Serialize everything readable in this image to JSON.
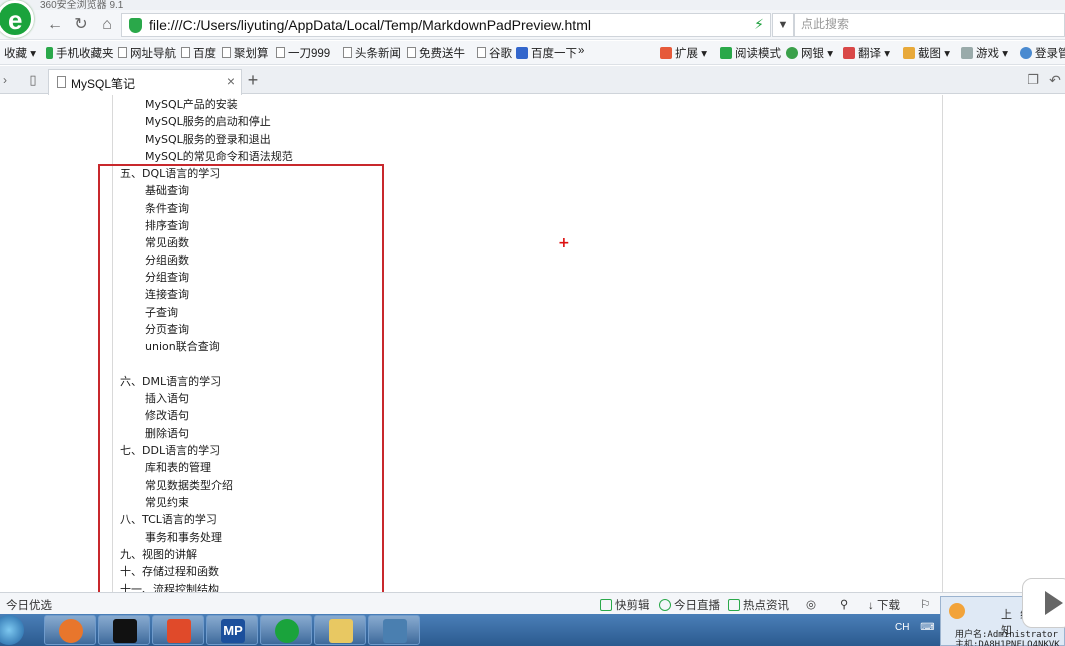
{
  "window": {
    "title": "360安全浏览器 9.1"
  },
  "nav": {
    "back_icon": "back-arrow-icon",
    "reload_icon": "reload-icon",
    "home_icon": "home-icon",
    "url": "file:///C:/Users/liyuting/AppData/Local/Temp/MarkdownPadPreview.html",
    "search_placeholder": "点此搜索"
  },
  "bookmarks": {
    "left": [
      "收藏",
      "手机收藏夹",
      "网址导航",
      "百度",
      "聚划算",
      "一刀999",
      "头条新闻",
      "免费送牛",
      "谷歌",
      "百度一下"
    ],
    "more": "»",
    "right": [
      "扩展",
      "阅读模式",
      "网银",
      "翻译",
      "截图",
      "游戏",
      "登录管"
    ]
  },
  "tabs": [
    {
      "label": "MySQL笔记"
    }
  ],
  "document": {
    "top_items": [
      "MySQL产品的安装",
      "MySQL服务的启动和停止",
      "MySQL服务的登录和退出",
      "MySQL的常见命令和语法规范"
    ],
    "sec5": {
      "title": "五、DQL语言的学习",
      "items": [
        "基础查询",
        "条件查询",
        "排序查询",
        "常见函数",
        "分组函数",
        "分组查询",
        "连接查询",
        "子查询",
        "分页查询",
        "union联合查询"
      ]
    },
    "sec6": {
      "title": "六、DML语言的学习",
      "items": [
        "插入语句",
        "修改语句",
        "删除语句"
      ]
    },
    "sec7": {
      "title": "七、DDL语言的学习",
      "items": [
        "库和表的管理",
        "常见数据类型介绍",
        "常见约束"
      ]
    },
    "sec8": {
      "title": "八、TCL语言的学习",
      "items": [
        "事务和事务处理"
      ]
    },
    "sec9": {
      "title": "九、视图的讲解"
    },
    "sec10": {
      "title": "十、存储过程和函数"
    },
    "sec11": {
      "title": "十一、流程控制结构"
    }
  },
  "status": {
    "left": "今日优选",
    "items": [
      "快剪辑",
      "今日直播",
      "热点资讯",
      "下载"
    ]
  },
  "tray": {
    "lang": "CH"
  },
  "popup": {
    "title": "上线通知",
    "user": "用户名:Administrator",
    "host": "主机:DA8H1PNFLO4NKVK"
  },
  "colors": {
    "highlight_box": "#c8282c",
    "accent_green": "#1aa33c"
  }
}
